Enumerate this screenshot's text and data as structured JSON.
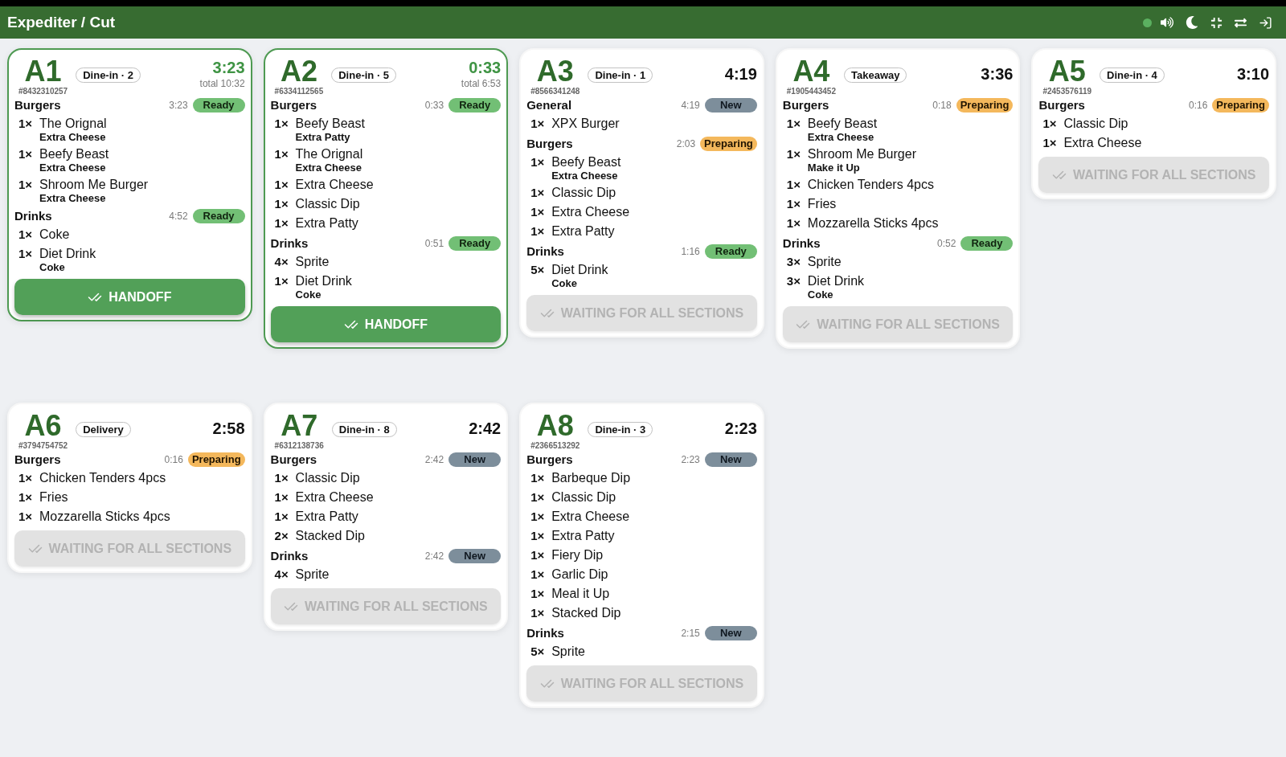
{
  "header": {
    "title": "Expediter / Cut",
    "connection": {
      "online": true
    }
  },
  "tickets": [
    {
      "number": "A1",
      "order_id": "#8432310257",
      "service": "Dine-in · 2",
      "timer": "3:23",
      "total": "total 10:32",
      "ready": true,
      "sections": [
        {
          "name": "Burgers",
          "elapsed": "3:23",
          "status": "Ready",
          "kind": "ready",
          "items": [
            {
              "qty": "1×",
              "name": "The Orignal",
              "modifier": "Extra Cheese"
            },
            {
              "qty": "1×",
              "name": "Beefy Beast",
              "modifier": "Extra Cheese"
            },
            {
              "qty": "1×",
              "name": "Shroom Me Burger",
              "modifier": "Extra Cheese"
            }
          ]
        },
        {
          "name": "Drinks",
          "elapsed": "4:52",
          "status": "Ready",
          "kind": "ready",
          "items": [
            {
              "qty": "1×",
              "name": "Coke"
            },
            {
              "qty": "1×",
              "name": "Diet Drink",
              "modifier": "Coke"
            }
          ]
        }
      ],
      "button": {
        "label": "HANDOFF",
        "disabled": false
      }
    },
    {
      "number": "A2",
      "order_id": "#6334112565",
      "service": "Dine-in · 5",
      "timer": "0:33",
      "total": "total 6:53",
      "ready": true,
      "sections": [
        {
          "name": "Burgers",
          "elapsed": "0:33",
          "status": "Ready",
          "kind": "ready",
          "items": [
            {
              "qty": "1×",
              "name": "Beefy Beast",
              "modifier": "Extra Patty"
            },
            {
              "qty": "1×",
              "name": "The Orignal",
              "modifier": "Extra Cheese"
            },
            {
              "qty": "1×",
              "name": "Extra Cheese"
            },
            {
              "qty": "1×",
              "name": "Classic Dip"
            },
            {
              "qty": "1×",
              "name": "Extra Patty"
            }
          ]
        },
        {
          "name": "Drinks",
          "elapsed": "0:51",
          "status": "Ready",
          "kind": "ready",
          "items": [
            {
              "qty": "4×",
              "name": "Sprite"
            },
            {
              "qty": "1×",
              "name": "Diet Drink",
              "modifier": "Coke"
            }
          ]
        }
      ],
      "button": {
        "label": "HANDOFF",
        "disabled": false
      }
    },
    {
      "number": "A3",
      "order_id": "#8566341248",
      "service": "Dine-in · 1",
      "timer": "4:19",
      "ready": false,
      "sections": [
        {
          "name": "General",
          "elapsed": "4:19",
          "status": "New",
          "kind": "new",
          "items": [
            {
              "qty": "1×",
              "name": "XPX Burger"
            }
          ]
        },
        {
          "name": "Burgers",
          "elapsed": "2:03",
          "status": "Preparing",
          "kind": "preparing",
          "items": [
            {
              "qty": "1×",
              "name": "Beefy Beast",
              "modifier": "Extra Cheese"
            },
            {
              "qty": "1×",
              "name": "Classic Dip"
            },
            {
              "qty": "1×",
              "name": "Extra Cheese"
            },
            {
              "qty": "1×",
              "name": "Extra Patty"
            }
          ]
        },
        {
          "name": "Drinks",
          "elapsed": "1:16",
          "status": "Ready",
          "kind": "ready",
          "items": [
            {
              "qty": "5×",
              "name": "Diet Drink",
              "modifier": "Coke"
            }
          ]
        }
      ],
      "button": {
        "label": "WAITING FOR ALL SECTIONS",
        "disabled": true
      }
    },
    {
      "number": "A4",
      "order_id": "#1905443452",
      "service": "Takeaway",
      "timer": "3:36",
      "ready": false,
      "sections": [
        {
          "name": "Burgers",
          "elapsed": "0:18",
          "status": "Preparing",
          "kind": "preparing",
          "items": [
            {
              "qty": "1×",
              "name": "Beefy Beast",
              "modifier": "Extra Cheese"
            },
            {
              "qty": "1×",
              "name": "Shroom Me Burger",
              "modifier": "Make it Up"
            },
            {
              "qty": "1×",
              "name": "Chicken Tenders 4pcs"
            },
            {
              "qty": "1×",
              "name": "Fries"
            },
            {
              "qty": "1×",
              "name": "Mozzarella Sticks 4pcs"
            }
          ]
        },
        {
          "name": "Drinks",
          "elapsed": "0:52",
          "status": "Ready",
          "kind": "ready",
          "items": [
            {
              "qty": "3×",
              "name": "Sprite"
            },
            {
              "qty": "3×",
              "name": "Diet Drink",
              "modifier": "Coke"
            }
          ]
        }
      ],
      "button": {
        "label": "WAITING FOR ALL SECTIONS",
        "disabled": true
      }
    },
    {
      "number": "A5",
      "order_id": "#2453576119",
      "service": "Dine-in · 4",
      "timer": "3:10",
      "ready": false,
      "sections": [
        {
          "name": "Burgers",
          "elapsed": "0:16",
          "status": "Preparing",
          "kind": "preparing",
          "items": [
            {
              "qty": "1×",
              "name": "Classic Dip"
            },
            {
              "qty": "1×",
              "name": "Extra Cheese"
            }
          ]
        }
      ],
      "button": {
        "label": "WAITING FOR ALL SECTIONS",
        "disabled": true
      }
    },
    {
      "number": "A6",
      "order_id": "#3794754752",
      "service": "Delivery",
      "timer": "2:58",
      "ready": false,
      "sections": [
        {
          "name": "Burgers",
          "elapsed": "0:16",
          "status": "Preparing",
          "kind": "preparing",
          "items": [
            {
              "qty": "1×",
              "name": "Chicken Tenders 4pcs"
            },
            {
              "qty": "1×",
              "name": "Fries"
            },
            {
              "qty": "1×",
              "name": "Mozzarella Sticks 4pcs"
            }
          ]
        }
      ],
      "button": {
        "label": "WAITING FOR ALL SECTIONS",
        "disabled": true
      }
    },
    {
      "number": "A7",
      "order_id": "#6312138736",
      "service": "Dine-in · 8",
      "timer": "2:42",
      "ready": false,
      "sections": [
        {
          "name": "Burgers",
          "elapsed": "2:42",
          "status": "New",
          "kind": "new",
          "items": [
            {
              "qty": "1×",
              "name": "Classic Dip"
            },
            {
              "qty": "1×",
              "name": "Extra Cheese"
            },
            {
              "qty": "1×",
              "name": "Extra Patty"
            },
            {
              "qty": "2×",
              "name": "Stacked Dip"
            }
          ]
        },
        {
          "name": "Drinks",
          "elapsed": "2:42",
          "status": "New",
          "kind": "new",
          "items": [
            {
              "qty": "4×",
              "name": "Sprite"
            }
          ]
        }
      ],
      "button": {
        "label": "WAITING FOR ALL SECTIONS",
        "disabled": true
      }
    },
    {
      "number": "A8",
      "order_id": "#2366513292",
      "service": "Dine-in · 3",
      "timer": "2:23",
      "ready": false,
      "sections": [
        {
          "name": "Burgers",
          "elapsed": "2:23",
          "status": "New",
          "kind": "new",
          "items": [
            {
              "qty": "1×",
              "name": "Barbeque Dip"
            },
            {
              "qty": "1×",
              "name": "Classic Dip"
            },
            {
              "qty": "1×",
              "name": "Extra Cheese"
            },
            {
              "qty": "1×",
              "name": "Extra Patty"
            },
            {
              "qty": "1×",
              "name": "Fiery Dip"
            },
            {
              "qty": "1×",
              "name": "Garlic Dip"
            },
            {
              "qty": "1×",
              "name": "Meal it Up"
            },
            {
              "qty": "1×",
              "name": "Stacked Dip"
            }
          ]
        },
        {
          "name": "Drinks",
          "elapsed": "2:15",
          "status": "New",
          "kind": "new",
          "items": [
            {
              "qty": "5×",
              "name": "Sprite"
            }
          ]
        }
      ],
      "button": {
        "label": "WAITING FOR ALL SECTIONS",
        "disabled": true
      }
    }
  ]
}
